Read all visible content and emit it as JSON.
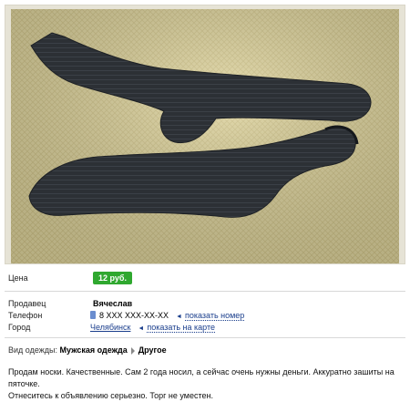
{
  "listing": {
    "price_label": "Цена",
    "price_value": "12 руб.",
    "seller_label": "Продавец",
    "seller_name": "Вячеслав",
    "phone_label": "Телефон",
    "phone_value": "8 XXX XXX-XX-XX",
    "phone_action": "показать номер",
    "city_label": "Город",
    "city_value": "Челябинск",
    "city_action": "показать на карте",
    "category_label": "Вид одежды:",
    "category_main": "Мужская одежда",
    "category_sub": "Другое",
    "description_line1": "Продам носки. Качественные. Сам 2 года носил, а сейчас очень нужны деньги. Аккуратно зашиты на пяточке.",
    "description_line2": "Отнеситесь к объявлению серьезно. Торг не уместен."
  },
  "colors": {
    "price_badge": "#2fa82f",
    "link": "#1a3e8c"
  },
  "icons": {
    "phone": "phone-icon",
    "left_arrow": "left-arrow-icon",
    "category_separator": "right-arrow-icon"
  }
}
